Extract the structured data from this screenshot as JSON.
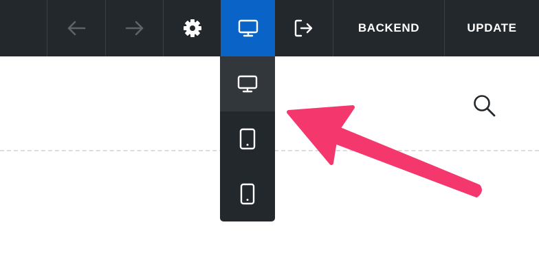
{
  "toolbar": {
    "undo_icon": "arrow-left-icon",
    "redo_icon": "arrow-right-icon",
    "settings_icon": "gear-icon",
    "responsive_icon": "desktop-icon",
    "exit_icon": "exit-icon",
    "backend_label": "BACKEND",
    "update_label": "UPDATE",
    "active_color": "#0a64c8",
    "background_color": "#23282d"
  },
  "content": {
    "search_icon": "search-icon"
  },
  "device_dropdown": {
    "items": [
      {
        "icon": "desktop-icon",
        "selected": true
      },
      {
        "icon": "tablet-icon",
        "selected": false
      },
      {
        "icon": "mobile-icon",
        "selected": false
      }
    ]
  },
  "annotation": {
    "arrow_color": "#f4376d"
  }
}
